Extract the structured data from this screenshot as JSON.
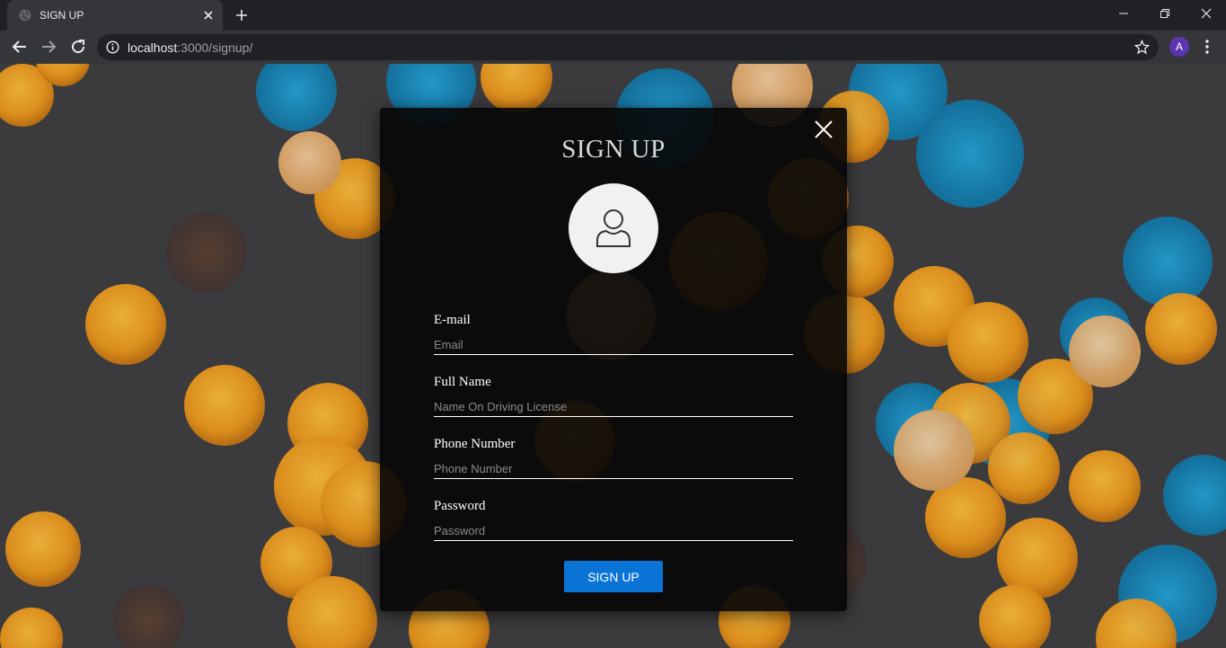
{
  "browser": {
    "tab_title": "SIGN UP",
    "url_host": "localhost",
    "url_path": ":3000/signup/",
    "profile_initial": "A"
  },
  "modal": {
    "title": "SIGN UP",
    "fields": [
      {
        "label": "E-mail",
        "placeholder": "Email"
      },
      {
        "label": "Full Name",
        "placeholder": "Name On Driving License"
      },
      {
        "label": "Phone Number",
        "placeholder": "Phone Number"
      },
      {
        "label": "Password",
        "placeholder": "Password"
      }
    ],
    "submit_label": "SIGN UP"
  },
  "colors": {
    "accent": "#0a74d6",
    "bokeh_orange": "#f5a623",
    "bokeh_blue": "#1e9fd6"
  }
}
